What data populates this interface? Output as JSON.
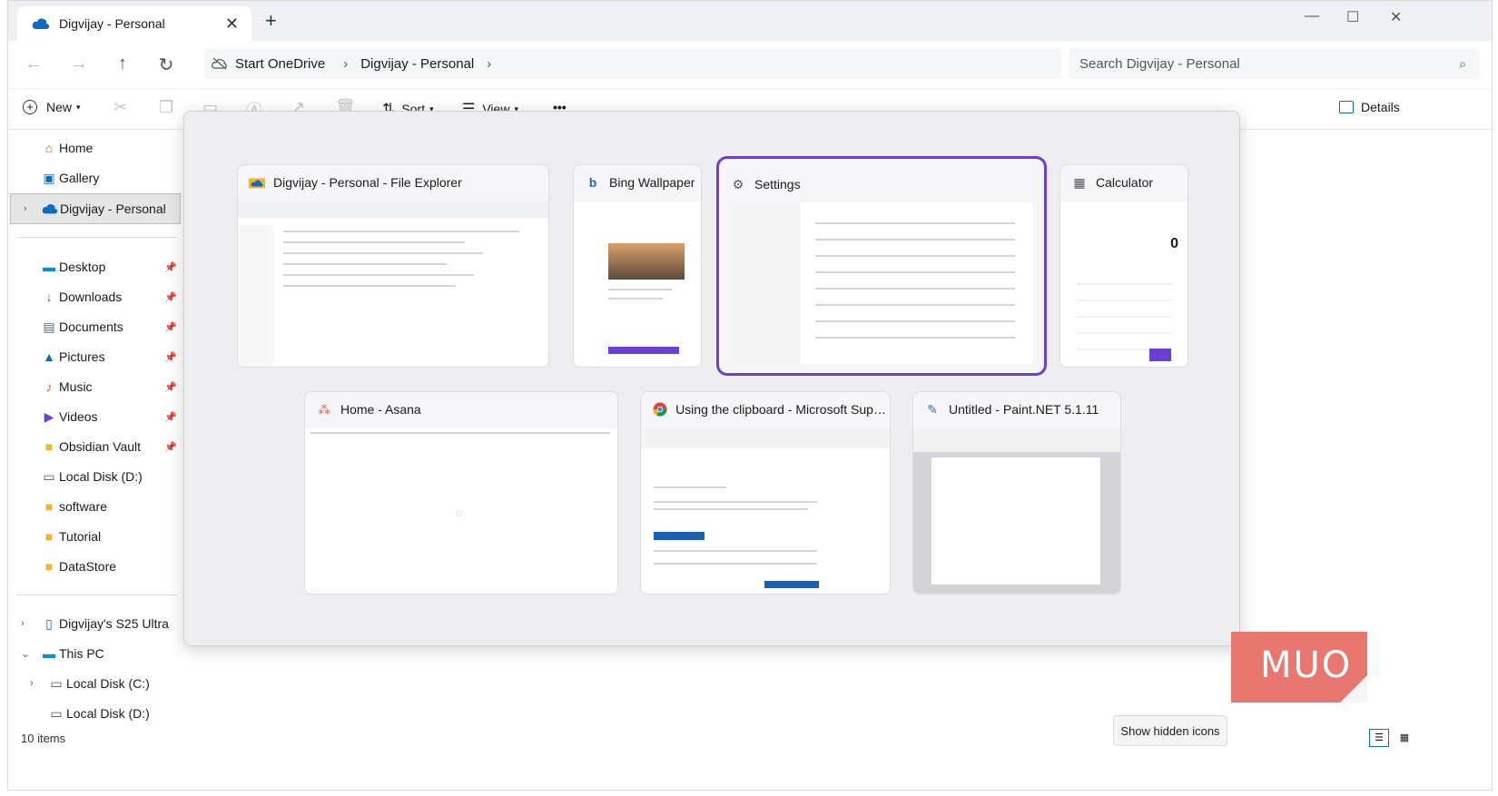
{
  "window": {
    "tab_title": "Digvijay - Personal",
    "tab_close": "✕",
    "new_tab": "+",
    "minimize": "—",
    "maximize": "☐",
    "close": "✕"
  },
  "address": {
    "crumbs": [
      "Start OneDrive",
      "›",
      "Digvijay - Personal",
      "›"
    ],
    "search_placeholder": "Search Digvijay - Personal"
  },
  "toolbar": {
    "new_label": "New",
    "sort_label": "Sort",
    "view_label": "View",
    "more_label": "•••",
    "details_label": "Details"
  },
  "sidebar": {
    "top": [
      {
        "label": "Home",
        "icon": "home-icon"
      },
      {
        "label": "Gallery",
        "icon": "gallery-icon"
      },
      {
        "label": "Digvijay - Personal",
        "icon": "cloud-icon"
      }
    ],
    "quick": [
      {
        "label": "Desktop",
        "icon": "desktop-icon"
      },
      {
        "label": "Downloads",
        "icon": "download-icon"
      },
      {
        "label": "Documents",
        "icon": "documents-icon"
      },
      {
        "label": "Pictures",
        "icon": "pictures-icon"
      },
      {
        "label": "Music",
        "icon": "music-icon"
      },
      {
        "label": "Videos",
        "icon": "videos-icon"
      },
      {
        "label": "Obsidian Vault",
        "icon": "folder-icon"
      },
      {
        "label": "Local Disk (D:)",
        "icon": "drive-icon"
      },
      {
        "label": "software",
        "icon": "folder-icon"
      },
      {
        "label": "Tutorial",
        "icon": "folder-icon"
      },
      {
        "label": "DataStore",
        "icon": "folder-icon"
      }
    ],
    "devices": [
      {
        "label": "Digvijay's S25 Ultra",
        "icon": "phone-icon"
      },
      {
        "label": "This PC",
        "icon": "pc-icon"
      },
      {
        "label": "Local Disk (C:)",
        "icon": "drive-icon"
      },
      {
        "label": "Local Disk (D:)",
        "icon": "drive-icon"
      }
    ]
  },
  "status": {
    "items": "10 items",
    "show_hidden_icons": "Show hidden icons"
  },
  "taskview": {
    "cards": [
      {
        "title": "Digvijay - Personal - File Explorer",
        "icon": "file-explorer-icon"
      },
      {
        "title": "Bing Wallpaper",
        "icon": "bing-icon"
      },
      {
        "title": "Settings",
        "icon": "settings-gear-icon",
        "active": true
      },
      {
        "title": "Calculator",
        "icon": "calculator-icon"
      },
      {
        "title": "Home - Asana",
        "icon": "asana-icon"
      },
      {
        "title": "Using the clipboard - Microsoft Suppor...",
        "icon": "chrome-icon"
      },
      {
        "title": "Untitled - Paint.NET 5.1.11",
        "icon": "paintnet-icon"
      }
    ],
    "calculator_display": "0"
  },
  "watermark": {
    "text": "MUO"
  },
  "colors": {
    "accent": "#6b3fd4",
    "watermark": "#e8776f",
    "onedrive": "#0f6cbd"
  }
}
